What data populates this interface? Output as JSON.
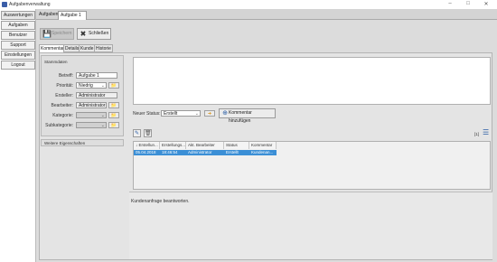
{
  "window": {
    "title": "Aufgabenverwaltung",
    "minimize_icon": "minimize-icon",
    "maximize_icon": "maximize-icon",
    "close_icon": "close-icon"
  },
  "sidebar": {
    "items": [
      {
        "label": "Auswertungen"
      },
      {
        "label": "Aufgaben"
      },
      {
        "label": "Benutzer"
      },
      {
        "label": "Support"
      },
      {
        "label": "Einstellungen"
      },
      {
        "label": "Logout"
      }
    ]
  },
  "tabs": [
    {
      "label": "Aufgaben"
    },
    {
      "label": "Aufgabe 1"
    }
  ],
  "toolbar": {
    "save_label": "Speichern",
    "close_label": "Schließen"
  },
  "subtabs": [
    {
      "label": "Kommentare"
    },
    {
      "label": "Details"
    },
    {
      "label": "Kunde"
    },
    {
      "label": "Historie"
    }
  ],
  "stammdaten": {
    "title": "Stammdaten",
    "betreff_label": "Betreff:",
    "betreff_value": "Aufgabe 1",
    "prioritaet_label": "Priorität:",
    "prioritaet_value": "Niedrig",
    "ersteller_label": "Ersteller:",
    "ersteller_value": "Administrator",
    "bearbeiter_label": "Bearbeiter:",
    "bearbeiter_value": "Administrator",
    "kategorie_label": "Kategorie:",
    "subkategorie_label": "Subkategorie:"
  },
  "weitere_label": "Weitere Eigenschaften",
  "status": {
    "label": "Neuer Status:",
    "value": "Erstellt",
    "add_comment_label": "Kommentar hinzufügen"
  },
  "grid": {
    "count_label": "[1]",
    "columns": [
      "↓ Erstellun...",
      "Erstellungs...",
      "Akt. Bearbeiter",
      "Status",
      "Kommentar"
    ],
    "rows": [
      [
        "05.04.2018",
        "18:46:54",
        "Administrator",
        "Erstellt",
        "Kundenan..."
      ]
    ]
  },
  "bottom_text": "Kundenanfrage beantworten.",
  "colors": {
    "selection": "#3b8fd6",
    "accent": "#2b5ea5"
  }
}
